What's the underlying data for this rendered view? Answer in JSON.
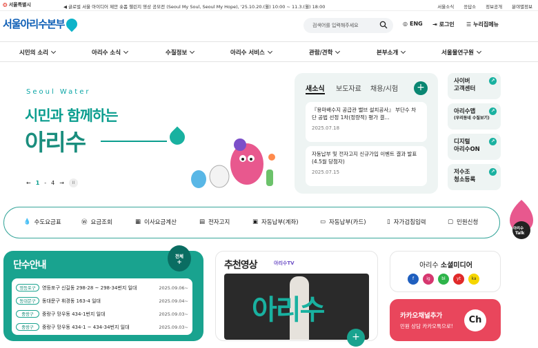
{
  "topbar": {
    "seoul_logo": "서울특별시",
    "notice": "글로벌 서울 아이디어 제안 숏폼 챌린지 영상 공모전 (Seoul My Soul, Seoul My Hope), '25.10.20.(월) 10:00 ~ 11.3.(월) 18:00",
    "links": [
      "서울소식",
      "응답소",
      "정보공개",
      "분야별정보"
    ]
  },
  "header": {
    "brand": "서울아리수본부",
    "search_placeholder": "검색어를 입력해주세요",
    "lang": "ENG",
    "login": "로그인",
    "sitemap": "누리집메뉴"
  },
  "gnb": [
    "시민의 소리",
    "아리수 소식",
    "수질정보",
    "아리수 서비스",
    "관람/견학",
    "본부소개",
    "서울물연구원"
  ],
  "hero": {
    "subtitle": "Seoul Water",
    "line1": "시민과 함께하는",
    "line2": "아리수",
    "pager_current": "1",
    "pager_sep": "-",
    "pager_total": "4",
    "prev": "←",
    "next": "→",
    "pause": "II"
  },
  "news": {
    "tabs": [
      "새소식",
      "보도자료",
      "채용/시험"
    ],
    "more": "+",
    "items": [
      {
        "title": "『용마배수지 공급관 밸브 설치공사』 부단수 차단 공법 선정 1차(정량적) 평가 결...",
        "date": "2025.07.18"
      },
      {
        "title": "자동납부 및 전자고지 신규가입 이벤트 결과 발표(4.5월 당첨자)",
        "date": "2025.07.15"
      }
    ]
  },
  "quick": [
    {
      "line1": "사이버",
      "line2": "고객센터",
      "small": ""
    },
    {
      "line1": "아리수맵",
      "line2": "",
      "small": "(우리동네 수질보기)"
    },
    {
      "line1": "디지털",
      "line2": "아리수ON",
      "small": ""
    },
    {
      "line1": "저수조",
      "line2": "청소등록",
      "small": ""
    }
  ],
  "services": [
    "수도요금표",
    "요금조회",
    "이사요금계산",
    "전자고지",
    "자동납부(계좌)",
    "자동납부(카드)",
    "자가검침입력",
    "민원신청"
  ],
  "talk": {
    "line1": "아리수",
    "line2": "Talk"
  },
  "watercut": {
    "title": "단수안내",
    "all_label": "전체",
    "all_plus": "+",
    "rows": [
      {
        "district": "영등포구",
        "place": "영등포구 신길동 298-28 ~ 298-34번지 일대",
        "date": "2025.09.06~"
      },
      {
        "district": "동대문구",
        "place": "동대문구 휘경동 163-4 일대",
        "date": "2025.09.04~"
      },
      {
        "district": "중랑구",
        "place": "중랑구 망우동 434-1번지 일대",
        "date": "2025.09.03~"
      },
      {
        "district": "중랑구",
        "place": "중랑구 망우동 434-1 ~ 434-34번지 일대",
        "date": "2025.09.03~"
      }
    ]
  },
  "video": {
    "title": "추천영상",
    "channel": "아리수TV",
    "thumb_text": "아리수",
    "more": "+"
  },
  "social": {
    "title_pre": "아리수 ",
    "title_bold": "소셜미디어",
    "icons": [
      "f",
      "ig",
      "bl",
      "yt",
      "ka"
    ]
  },
  "kakao": {
    "title": "카카오채널추가",
    "subtitle": "민원 상담 카카오톡으로!",
    "ch": "Ch"
  },
  "colors": {
    "primary": "#19a38f",
    "brand_blue": "#0b5db5",
    "kakao_bg": "#e9465c"
  }
}
